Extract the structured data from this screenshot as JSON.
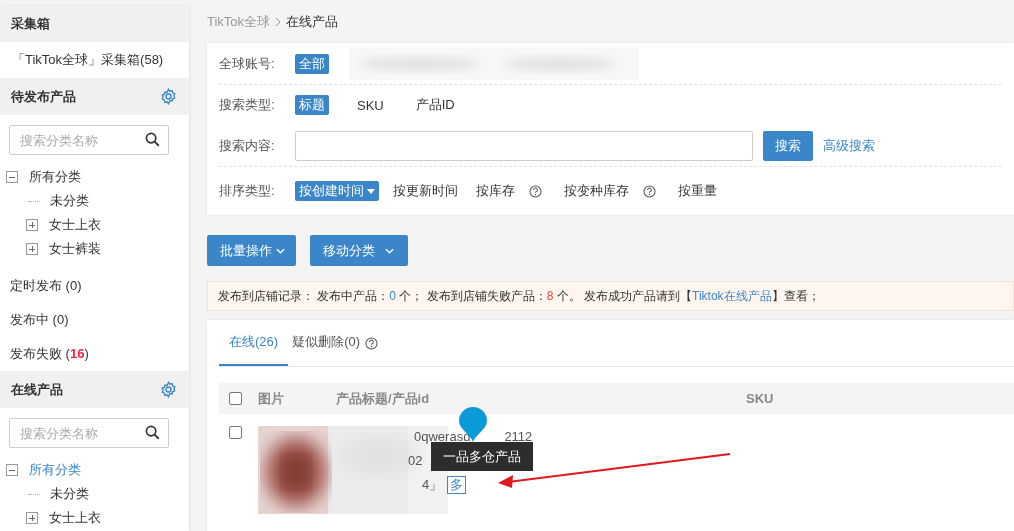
{
  "sidebar": [
    {
      "kind": "header",
      "title": "采集箱",
      "settings": false
    },
    {
      "kind": "link",
      "text": "「TikTok全球」采集箱(58)"
    },
    {
      "kind": "header",
      "title": "待发布产品",
      "settings": true
    },
    {
      "kind": "search",
      "placeholder": "搜索分类名称"
    },
    {
      "kind": "tree",
      "nodes": [
        {
          "label": "所有分类",
          "expanded": true,
          "selected": false,
          "children": [
            {
              "label": "未分类"
            },
            {
              "label": "女士上衣",
              "expanded": false
            },
            {
              "label": "女士裤装",
              "expanded": false
            }
          ]
        }
      ]
    },
    {
      "kind": "status",
      "text": "定时发布 (0)"
    },
    {
      "kind": "status",
      "text": "发布中 (0)"
    },
    {
      "kind": "status",
      "text": "发布失败 (",
      "count": "16",
      "after": ")",
      "alert": true
    },
    {
      "kind": "header",
      "title": "在线产品",
      "settings": true
    },
    {
      "kind": "search",
      "placeholder": "搜索分类名称"
    },
    {
      "kind": "tree",
      "nodes": [
        {
          "label": "所有分类",
          "expanded": true,
          "selected": true,
          "children": [
            {
              "label": "未分类"
            },
            {
              "label": "女士上衣",
              "expanded": false
            }
          ]
        }
      ]
    }
  ],
  "breadcrumb": {
    "parent": "TikTok全球",
    "current": "在线产品"
  },
  "filters": {
    "account": {
      "label": "全球账号:",
      "options": [
        {
          "label": "全部",
          "selected": true
        }
      ]
    },
    "search_type": {
      "label": "搜索类型:",
      "options": [
        {
          "label": "标题",
          "selected": true
        },
        {
          "label": "SKU",
          "selected": false
        },
        {
          "label": "产品ID",
          "selected": false
        }
      ]
    },
    "search_content": {
      "label": "搜索内容:",
      "button": "搜索",
      "advanced_link": "高级搜索"
    },
    "sort": {
      "label": "排序类型:",
      "options": [
        {
          "label": "按创建时间",
          "selected": true,
          "dropdown": true,
          "help": false
        },
        {
          "label": "按更新时间",
          "selected": false,
          "dropdown": false,
          "help": false
        },
        {
          "label": "按库存",
          "selected": false,
          "dropdown": false,
          "help": true
        },
        {
          "label": "按变种库存",
          "selected": false,
          "dropdown": false,
          "help": true
        },
        {
          "label": "按重量",
          "selected": false,
          "dropdown": false,
          "help": false
        }
      ]
    }
  },
  "actions": [
    {
      "label": "批量操作"
    },
    {
      "label": "移动分类"
    }
  ],
  "notice": [
    {
      "kind": "text",
      "text": "发布到店铺记录： 发布中产品："
    },
    {
      "kind": "count",
      "text": "0",
      "color": "#3a86c8"
    },
    {
      "kind": "text",
      "text": " 个； 发布到店铺失败产品："
    },
    {
      "kind": "count",
      "text": "8",
      "color": "#e94a4a"
    },
    {
      "kind": "text",
      "text": " 个。 发布成功产品请到【"
    },
    {
      "kind": "link",
      "text": "Tiktok在线产品"
    },
    {
      "kind": "text",
      "text": "】查看；"
    }
  ],
  "tabs": [
    {
      "label": "在线(26)",
      "selected": true,
      "help": false
    },
    {
      "label": "疑似删除(0)",
      "selected": false,
      "help": true
    }
  ],
  "table": {
    "checked": false,
    "columns": [
      "图片",
      "产品标题/产品id",
      "SKU"
    ],
    "rows": [
      {
        "checked": false,
        "title_start": "0qwerasd",
        "title_end": "2112",
        "line_2": "02",
        "line_3": "4」",
        "badge": "多",
        "tooltip": "一品多仓产品"
      }
    ]
  }
}
